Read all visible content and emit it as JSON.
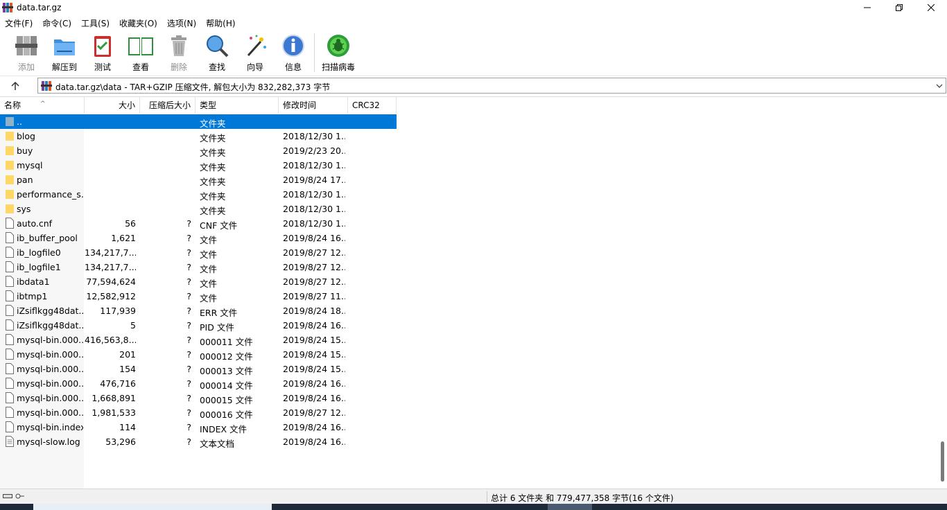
{
  "window": {
    "title": "data.tar.gz"
  },
  "menu": [
    "文件(F)",
    "命令(C)",
    "工具(S)",
    "收藏夹(O)",
    "选项(N)",
    "帮助(H)"
  ],
  "toolbar": {
    "add": "添加",
    "extract": "解压到",
    "test": "测试",
    "view": "查看",
    "delete": "删除",
    "find": "查找",
    "wizard": "向导",
    "info": "信息",
    "scan": "扫描病毒"
  },
  "address": {
    "path": "data.tar.gz\\data - TAR+GZIP 压缩文件, 解包大小为 832,282,373 字节"
  },
  "columns": {
    "name": "名称",
    "size": "大小",
    "packed": "压缩后大小",
    "type": "类型",
    "modified": "修改时间",
    "crc": "CRC32"
  },
  "rows": [
    {
      "name": "..",
      "size": "",
      "packed": "",
      "type": "文件夹",
      "modified": "",
      "icon": "up-folder-icon",
      "selected": true
    },
    {
      "name": "blog",
      "size": "",
      "packed": "",
      "type": "文件夹",
      "modified": "2018/12/30 1...",
      "icon": "folder-icon"
    },
    {
      "name": "buy",
      "size": "",
      "packed": "",
      "type": "文件夹",
      "modified": "2019/2/23 20...",
      "icon": "folder-icon"
    },
    {
      "name": "mysql",
      "size": "",
      "packed": "",
      "type": "文件夹",
      "modified": "2018/12/30 1...",
      "icon": "folder-icon"
    },
    {
      "name": "pan",
      "size": "",
      "packed": "",
      "type": "文件夹",
      "modified": "2019/8/24 17...",
      "icon": "folder-icon"
    },
    {
      "name": "performance_s...",
      "size": "",
      "packed": "",
      "type": "文件夹",
      "modified": "2018/12/30 1...",
      "icon": "folder-icon"
    },
    {
      "name": "sys",
      "size": "",
      "packed": "",
      "type": "文件夹",
      "modified": "2018/12/30 1...",
      "icon": "folder-icon"
    },
    {
      "name": "auto.cnf",
      "size": "56",
      "packed": "?",
      "type": "CNF 文件",
      "modified": "2018/12/30 1...",
      "icon": "file-icon"
    },
    {
      "name": "ib_buffer_pool",
      "size": "1,621",
      "packed": "?",
      "type": "文件",
      "modified": "2019/8/24 16...",
      "icon": "file-icon"
    },
    {
      "name": "ib_logfile0",
      "size": "134,217,7...",
      "packed": "?",
      "type": "文件",
      "modified": "2019/8/27 12...",
      "icon": "file-icon"
    },
    {
      "name": "ib_logfile1",
      "size": "134,217,7...",
      "packed": "?",
      "type": "文件",
      "modified": "2019/8/27 12...",
      "icon": "file-icon"
    },
    {
      "name": "ibdata1",
      "size": "77,594,624",
      "packed": "?",
      "type": "文件",
      "modified": "2019/8/27 12...",
      "icon": "file-icon"
    },
    {
      "name": "ibtmp1",
      "size": "12,582,912",
      "packed": "?",
      "type": "文件",
      "modified": "2019/8/27 11...",
      "icon": "file-icon"
    },
    {
      "name": "iZsiflkgg48dat...",
      "size": "117,939",
      "packed": "?",
      "type": "ERR 文件",
      "modified": "2019/8/24 18...",
      "icon": "file-icon"
    },
    {
      "name": "iZsiflkgg48dat...",
      "size": "5",
      "packed": "?",
      "type": "PID 文件",
      "modified": "2019/8/24 16...",
      "icon": "file-icon"
    },
    {
      "name": "mysql-bin.000...",
      "size": "416,563,8...",
      "packed": "?",
      "type": "000011 文件",
      "modified": "2019/8/24 15...",
      "icon": "file-icon"
    },
    {
      "name": "mysql-bin.000...",
      "size": "201",
      "packed": "?",
      "type": "000012 文件",
      "modified": "2019/8/24 15...",
      "icon": "file-icon"
    },
    {
      "name": "mysql-bin.000...",
      "size": "154",
      "packed": "?",
      "type": "000013 文件",
      "modified": "2019/8/24 15...",
      "icon": "file-icon"
    },
    {
      "name": "mysql-bin.000...",
      "size": "476,716",
      "packed": "?",
      "type": "000014 文件",
      "modified": "2019/8/24 16...",
      "icon": "file-icon"
    },
    {
      "name": "mysql-bin.000...",
      "size": "1,668,891",
      "packed": "?",
      "type": "000015 文件",
      "modified": "2019/8/24 16...",
      "icon": "file-icon"
    },
    {
      "name": "mysql-bin.000...",
      "size": "1,981,533",
      "packed": "?",
      "type": "000016 文件",
      "modified": "2019/8/27 12...",
      "icon": "file-icon"
    },
    {
      "name": "mysql-bin.index",
      "size": "114",
      "packed": "?",
      "type": "INDEX 文件",
      "modified": "2019/8/24 16...",
      "icon": "file-icon"
    },
    {
      "name": "mysql-slow.log",
      "size": "53,296",
      "packed": "?",
      "type": "文本文档",
      "modified": "2019/8/24 16...",
      "icon": "text-file-icon"
    }
  ],
  "status": {
    "summary": "总计 6 文件夹 和 779,477,358 字节(16 个文件)"
  },
  "colors": {
    "selection": "#0078d7",
    "folder": "#ffd766"
  }
}
